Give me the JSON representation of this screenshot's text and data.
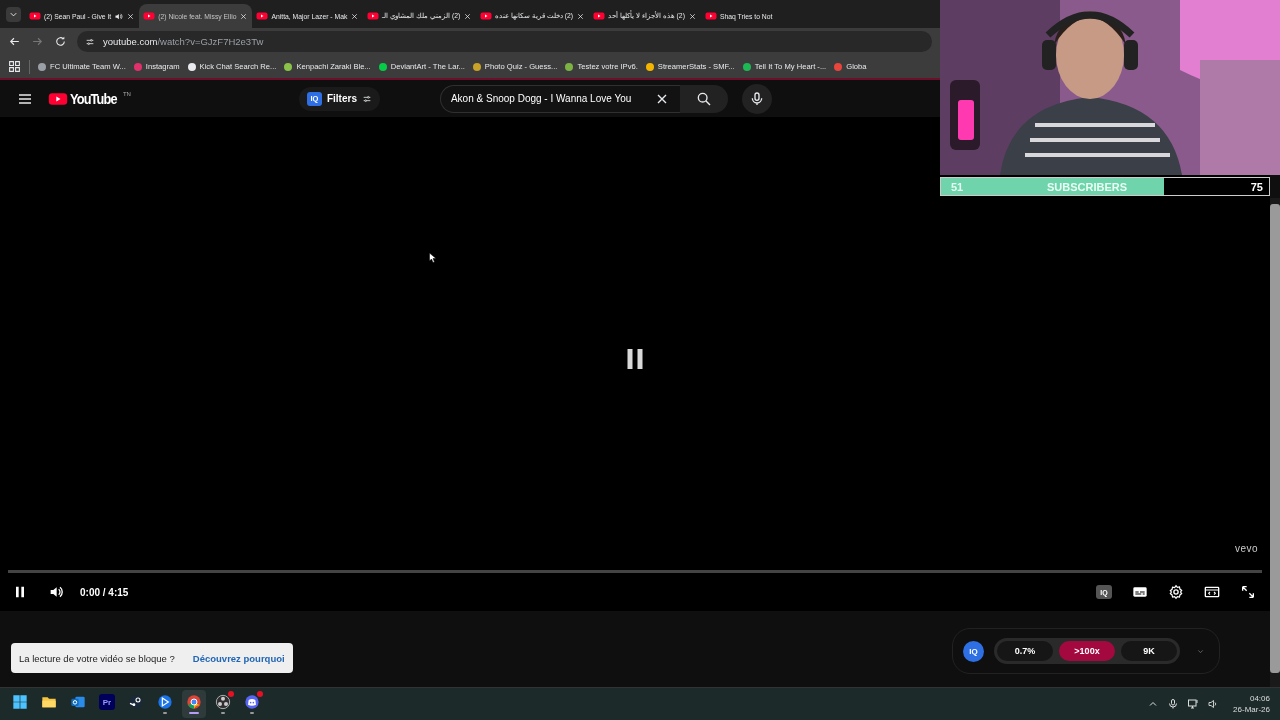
{
  "tabs": [
    {
      "title": "(2) Sean Paul - Give It",
      "selected": false,
      "audio": true,
      "closable": true
    },
    {
      "title": "(2) Nicole feat. Missy Ellio",
      "selected": true,
      "audio": false,
      "closable": true
    },
    {
      "title": "Anitta, Major Lazer - Mak",
      "selected": false,
      "audio": false,
      "closable": true
    },
    {
      "title": "(2) الزمني ملك المشاوي الـ",
      "selected": false,
      "audio": false,
      "closable": true
    },
    {
      "title": "(2) دخلت قرية سكانها عنده",
      "selected": false,
      "audio": false,
      "closable": true
    },
    {
      "title": "(2) هذه الأجزاء لا يأكلها أحد",
      "selected": false,
      "audio": false,
      "closable": true
    },
    {
      "title": "Shaq Tries to Not",
      "selected": false,
      "audio": false,
      "closable": false
    }
  ],
  "address_bar": {
    "domain": "youtube.com",
    "path": "/watch?v=GJzF7H2e3Tw"
  },
  "bookmarks": [
    {
      "title": "FC Ultimate Team W...",
      "color": "#9aa0a6"
    },
    {
      "title": "Instagram",
      "color": "#e1306c"
    },
    {
      "title": "Kick Chat Search Re...",
      "color": "#e8eaed"
    },
    {
      "title": "Kenpachi Zaraki Ble...",
      "color": "#8bc34a"
    },
    {
      "title": "DeviantArt - The Lar...",
      "color": "#05cc47"
    },
    {
      "title": "Photo Quiz - Guess...",
      "color": "#c9a227"
    },
    {
      "title": "Testez votre IPv6.",
      "color": "#7cb342"
    },
    {
      "title": "StreamerStats - SMF...",
      "color": "#f4b400"
    },
    {
      "title": "Tell It To My Heart -...",
      "color": "#1db954"
    },
    {
      "title": "Globa",
      "color": "#e8453c"
    }
  ],
  "youtube": {
    "logo": "YouTube",
    "region": "TN",
    "filters": {
      "badge": "IQ",
      "label": "Filters"
    },
    "search": {
      "value": "Akon & Snoop Dogg - I Wanna Love You"
    }
  },
  "player": {
    "playing": true,
    "time": "0:00 / 4:15",
    "badge": "IQ",
    "watermark": "vevo",
    "progress": {
      "level": 0
    }
  },
  "notice": {
    "text": "La lecture de votre vidéo se bloque ?",
    "link": "Découvrez pourquoi"
  },
  "iq_widget": {
    "badge": "IQ",
    "stats": [
      {
        "value": "0.7%",
        "highlighted": false
      },
      {
        "value": ">100x",
        "highlighted": true
      },
      {
        "value": "9K",
        "highlighted": false
      }
    ]
  },
  "subscriber_goal": {
    "current": "51",
    "label": "SUBSCRIBERS",
    "goal": "75",
    "level": 0.68
  },
  "taskbar": {
    "apps": [
      {
        "kind": "start",
        "running": false,
        "active": false,
        "notification": false
      },
      {
        "kind": "folder",
        "running": false,
        "active": false,
        "notification": false
      },
      {
        "kind": "outlook",
        "running": false,
        "active": false,
        "notification": false
      },
      {
        "kind": "premiere",
        "label": "Pr",
        "running": false,
        "active": false,
        "notification": false
      },
      {
        "kind": "steam",
        "running": false,
        "active": false,
        "notification": false
      },
      {
        "kind": "bluestar",
        "running": true,
        "active": false,
        "notification": false
      },
      {
        "kind": "chrome",
        "running": true,
        "active": true,
        "notification": false
      },
      {
        "kind": "obs",
        "running": true,
        "active": false,
        "notification": true
      },
      {
        "kind": "discord",
        "running": true,
        "active": false,
        "notification": true
      }
    ],
    "clock": {
      "time": "04:06",
      "date": "26-Mar-26"
    }
  }
}
